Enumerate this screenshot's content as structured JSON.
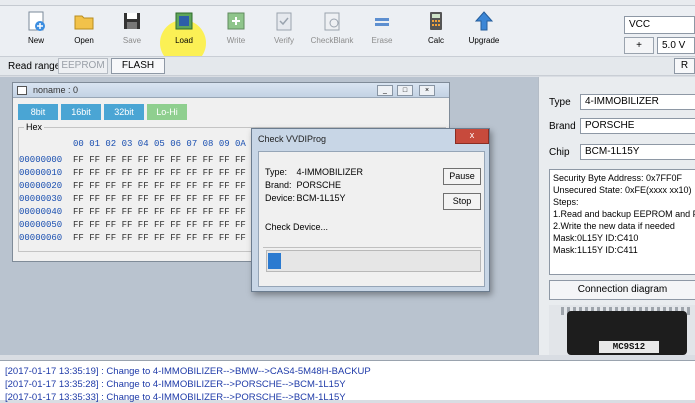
{
  "toolbar": {
    "buttons": [
      {
        "label": "New",
        "icon": "new-file-icon",
        "enabled": true
      },
      {
        "label": "Open",
        "icon": "folder-open-icon",
        "enabled": true
      },
      {
        "label": "Save",
        "icon": "floppy-save-icon",
        "enabled": false
      },
      {
        "label": "Load",
        "icon": "load-chip-icon",
        "enabled": true
      },
      {
        "label": "Write",
        "icon": "write-chip-icon",
        "enabled": false
      },
      {
        "label": "Verify",
        "icon": "verify-icon",
        "enabled": false
      },
      {
        "label": "CheckBlank",
        "icon": "check-blank-icon",
        "enabled": false
      },
      {
        "label": "Erase",
        "icon": "erase-icon",
        "enabled": false
      },
      {
        "label": "Calc",
        "icon": "calculator-icon",
        "enabled": true
      },
      {
        "label": "Upgrade",
        "icon": "upgrade-arrow-icon",
        "enabled": true
      }
    ],
    "vcc_label": "VCC",
    "plus_label": "+",
    "voltage_value": "5.0 V"
  },
  "read_range": {
    "label": "Read range",
    "eeprom_label": "EEPROM",
    "flash_label": "FLASH",
    "right_button_label": "R"
  },
  "hex_window": {
    "title": "noname : 0",
    "bit_buttons": [
      "8bit",
      "16bit",
      "32bit",
      "Lo-Hi"
    ],
    "group_label": "Hex",
    "columns": "00 01 02 03 04 05 06 07 08 09 0A",
    "rows": [
      {
        "addr": "00000000",
        "bytes": "FF FF FF FF FF FF FF FF FF FF FF"
      },
      {
        "addr": "00000010",
        "bytes": "FF FF FF FF FF FF FF FF FF FF FF"
      },
      {
        "addr": "00000020",
        "bytes": "FF FF FF FF FF FF FF FF FF FF FF"
      },
      {
        "addr": "00000030",
        "bytes": "FF FF FF FF FF FF FF FF FF FF FF"
      },
      {
        "addr": "00000040",
        "bytes": "FF FF FF FF FF FF FF FF FF FF FF"
      },
      {
        "addr": "00000050",
        "bytes": "FF FF FF FF FF FF FF FF FF FF FF"
      },
      {
        "addr": "00000060",
        "bytes": "FF FF FF FF FF FF FF FF FF FF FF"
      }
    ]
  },
  "right_panel": {
    "type_label": "Type",
    "type_value": "4-IMMOBILIZER",
    "brand_label": "Brand",
    "brand_value": "PORSCHE",
    "chip_label": "Chip",
    "chip_value": "BCM-1L15Y",
    "info_lines": [
      "Security Byte Address: 0x7FF0F",
      "Unsecured State: 0xFE(xxxx xx10)",
      "Steps:",
      "1.Read and backup EEPROM and FLASH",
      "2.Write the new data if needed",
      "Mask:0L15Y ID:C410",
      "Mask:1L15Y ID:C411"
    ],
    "connection_button": "Connection diagram",
    "chip_marking": "MC9S12"
  },
  "log": [
    {
      "time": "[2017-01-17 13:35:19]",
      "text": "Change to 4-IMMOBILIZER-->BMW-->CAS4-5M48H-BACKUP"
    },
    {
      "time": "[2017-01-17 13:35:28]",
      "text": "Change to 4-IMMOBILIZER-->PORSCHE-->BCM-1L15Y"
    },
    {
      "time": "[2017-01-17 13:35:33]",
      "text": "Change to 4-IMMOBILIZER-->PORSCHE-->BCM-1L15Y"
    }
  ],
  "dialog": {
    "title": "Check VVDIProg",
    "close_label": "x",
    "type_key": "Type:",
    "type_value": "4-IMMOBILIZER",
    "brand_key": "Brand:",
    "brand_value": "PORSCHE",
    "device_key": "Device:",
    "device_value": "BCM-1L15Y",
    "status": "Check Device...",
    "pause_label": "Pause",
    "stop_label": "Stop",
    "progress": 0.06
  },
  "colors": {
    "bit_button": "#4aa5d4",
    "lohi_button": "#8fcf8f",
    "log_text": "#1e3aa8",
    "progress_fill": "#2b7ad0",
    "close_button": "#c74a3c"
  }
}
